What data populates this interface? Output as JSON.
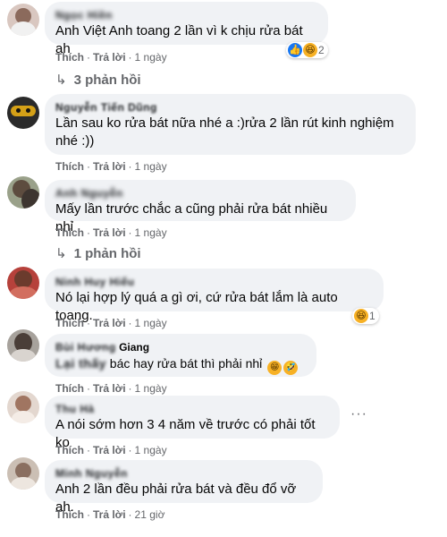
{
  "actions": {
    "like": "Thích",
    "reply": "Trả lời"
  },
  "comments": [
    {
      "author": "Ngọc Hiền",
      "text": "Anh Việt Anh toang 2 lần vì k chịu rửa bát ah",
      "time": "1 ngày",
      "reactions": {
        "icons": [
          "like-icon",
          "haha-icon"
        ],
        "count": "2"
      },
      "replies": "3 phản hồi"
    },
    {
      "author": "Nguyễn Tiến Dũng",
      "text_line1": "Lần sau ko rửa bát nữa nhé a :)rửa 2 lần rút kinh nghiệm",
      "text_line2": "nhé :))",
      "time": "1 ngày"
    },
    {
      "author": "Anh Nguyễn",
      "text": "Mấy lần trước chắc a cũng phải rửa bát nhiều nhỉ",
      "time": "1 ngày",
      "replies": "1 phản hồi"
    },
    {
      "author": "Ninh Huy Hiếu",
      "text": "Nó lại hợp lý quá a gì ơi, cứ rửa bát lắm là auto toang.",
      "time": "1 ngày",
      "reactions": {
        "icons": [
          "haha-icon"
        ],
        "count": "1"
      }
    },
    {
      "author_hidden": "Bùi Hương",
      "author_visible": "Giang",
      "text_hidden": "Lại thấy",
      "text": "bác hay rửa bát thì phải nhỉ",
      "emojis": [
        "😁",
        "🤣"
      ],
      "time": "1 ngày"
    },
    {
      "author": "Thu Hà",
      "text": "A nói sớm hơn 3 4 năm về trước có phải tốt ko",
      "time": "1 ngày"
    },
    {
      "author": "Minh Nguyễn",
      "text": "Anh 2 lần đều phải rửa bát và đều đổ vỡ ah.",
      "time": "21 giờ"
    }
  ],
  "colors": {
    "bubble": "#f0f2f5",
    "meta": "#65676b",
    "like": "#1877f2",
    "haha": "#f7b125"
  }
}
